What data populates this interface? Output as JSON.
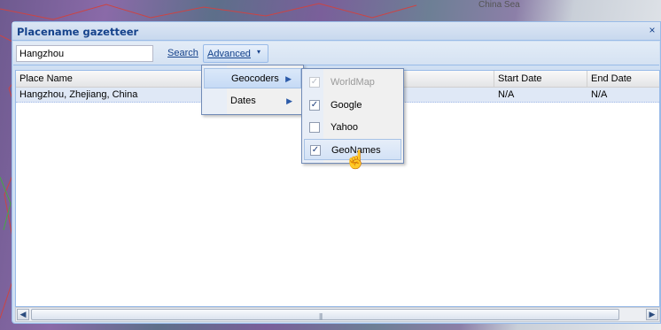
{
  "background": {
    "map_label": "China Sea"
  },
  "window": {
    "title": "Placename gazetteer",
    "close_symbol": "×"
  },
  "toolbar": {
    "search_value": "Hangzhou",
    "search_link": "Search",
    "advanced_label": "Advanced",
    "advanced_caret": "▾"
  },
  "grid": {
    "columns": [
      "Place Name",
      "Start Date",
      "End Date"
    ],
    "rows": [
      {
        "place": "Hangzhou, Zhejiang, China",
        "start": "N/A",
        "end": "N/A"
      }
    ]
  },
  "menu": {
    "items": [
      {
        "label": "Geocoders",
        "active": true
      },
      {
        "label": "Dates",
        "active": false
      }
    ],
    "arrow_symbol": "▶"
  },
  "submenu": {
    "items": [
      {
        "label": "WorldMap",
        "checked": true,
        "disabled": true
      },
      {
        "label": "Google",
        "checked": true,
        "disabled": false
      },
      {
        "label": "Yahoo",
        "checked": false,
        "disabled": false
      },
      {
        "label": "GeoNames",
        "checked": true,
        "disabled": false
      }
    ],
    "check_symbol": "✓"
  },
  "scrollbar": {
    "left_symbol": "◀",
    "right_symbol": "▶",
    "grip_symbol": "|||"
  },
  "colors": {
    "accent": "#15428b",
    "border": "#99bbe8",
    "selected_row": "#dfe8f6"
  }
}
